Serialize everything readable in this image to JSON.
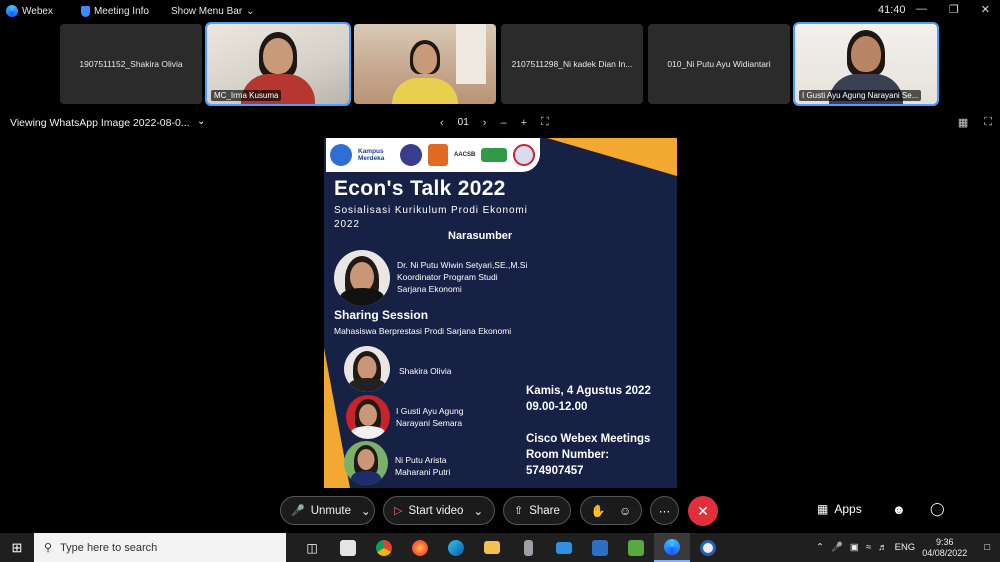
{
  "titlebar": {
    "app_name": "Webex",
    "meeting_info": "Meeting Info",
    "menu_bar": "Show Menu Bar",
    "timer": "41:40"
  },
  "participants": [
    {
      "name": "1907511152_Shakira Olivia",
      "video": false,
      "active": false
    },
    {
      "name": "MC_Irma Kusuma",
      "video": true,
      "active": true
    },
    {
      "name": "",
      "video": true,
      "active": false
    },
    {
      "name": "2107511298_Ni kadek Dian In...",
      "video": false,
      "active": false
    },
    {
      "name": "010_Ni Putu Ayu Widiantari",
      "video": false,
      "active": false
    },
    {
      "name": "I Gusti Ayu Agung Narayani Se...",
      "video": true,
      "active": true
    }
  ],
  "share": {
    "title": "Viewing WhatsApp Image 2022-08-0...",
    "page": "01"
  },
  "poster": {
    "logo_text": "Kampus Merdeka",
    "logo_aacsb": "AACSB",
    "title": "Econ's Talk 2022",
    "subtitle": "Sosialisasi Kurikulum Prodi Ekonomi 2022",
    "narasumber_heading": "Narasumber",
    "speaker_name": "Dr. Ni Putu Wiwin Setyari,SE.,M.Si",
    "speaker_role_1": "Koordinator Program Studi",
    "speaker_role_2": "Sarjana Ekonomi",
    "sharing_heading": "Sharing Session",
    "sharing_sub": "Mahasiswa Berprestasi Prodi Sarjana Ekonomi",
    "student_1": "Shakira Olivia",
    "student_2_line1": "I Gusti Ayu Agung",
    "student_2_line2": "Narayani Semara",
    "student_3_line1": "Ni Putu Arista",
    "student_3_line2": "Maharani Putri",
    "date_line": "Kamis, 4 Agustus 2022",
    "time_line": "09.00-12.00",
    "room_line1": "Cisco Webex Meetings",
    "room_line2": "Room Number:",
    "room_line3": "574907457"
  },
  "controls": {
    "unmute": "Unmute",
    "start_video": "Start video",
    "share": "Share",
    "apps": "Apps"
  },
  "taskbar": {
    "search_placeholder": "Type here to search",
    "lang": "ENG",
    "time": "9:36",
    "date": "04/08/2022"
  },
  "colors": {
    "poster_bg": "#172145",
    "poster_accent": "#f3a82f",
    "active_outline": "#4d9fff",
    "end_call": "#e0313b"
  }
}
